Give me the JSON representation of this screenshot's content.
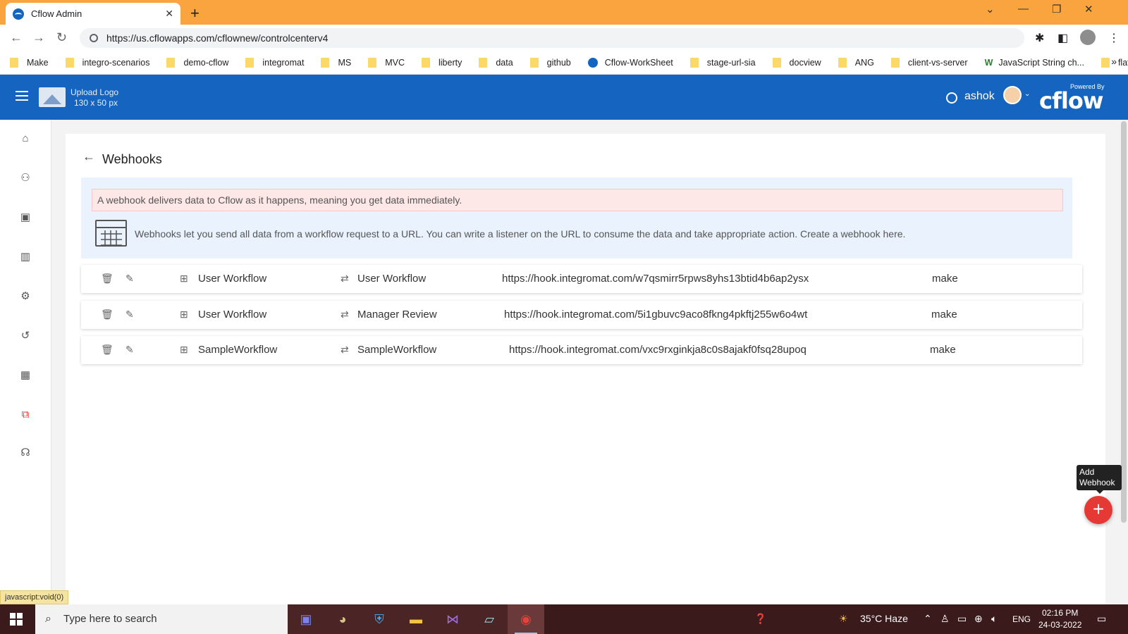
{
  "browser": {
    "tab_title": "Cflow Admin",
    "url": "https://us.cflowapps.com/cflownew/controlcenterv4",
    "bookmarks": [
      {
        "label": "Make",
        "type": "folder"
      },
      {
        "label": "integro-scenarios",
        "type": "folder"
      },
      {
        "label": "demo-cflow",
        "type": "folder"
      },
      {
        "label": "integromat",
        "type": "folder"
      },
      {
        "label": "MS",
        "type": "folder"
      },
      {
        "label": "MVC",
        "type": "folder"
      },
      {
        "label": "liberty",
        "type": "folder"
      },
      {
        "label": "data",
        "type": "folder"
      },
      {
        "label": "github",
        "type": "folder"
      },
      {
        "label": "Cflow-WorkSheet",
        "type": "cflow"
      },
      {
        "label": "stage-url-sia",
        "type": "folder"
      },
      {
        "label": "docview",
        "type": "folder"
      },
      {
        "label": "ANG",
        "type": "folder"
      },
      {
        "label": "client-vs-server",
        "type": "folder"
      },
      {
        "label": "JavaScript String ch...",
        "type": "w"
      },
      {
        "label": "flat",
        "type": "folder"
      }
    ]
  },
  "header": {
    "upload_logo_line1": "Upload Logo",
    "upload_logo_line2": "130 x 50 px",
    "username": "ashok",
    "powered_by": "Powered By",
    "brand": "cflow",
    "brand_color": "#1565c0"
  },
  "sidebar": {
    "items": [
      {
        "icon": "home-icon"
      },
      {
        "icon": "workflow-icon"
      },
      {
        "icon": "calendar-icon"
      },
      {
        "icon": "reports-icon"
      },
      {
        "icon": "user-settings-icon"
      },
      {
        "icon": "history-icon"
      },
      {
        "icon": "dashboard-icon"
      },
      {
        "icon": "integrations-icon",
        "active": true
      },
      {
        "icon": "support-icon"
      }
    ],
    "active_color": "#e53935"
  },
  "page": {
    "title": "Webhooks",
    "notice": "A webhook delivers data to Cflow as it happens, meaning you get data immediately.",
    "info": "Webhooks let you send all data from a workflow request to a URL. You can write a listener on the URL to consume the data and take appropriate action. Create a webhook here."
  },
  "webhooks": [
    {
      "workflow": "User Workflow",
      "stage": "User Workflow",
      "url": "https://hook.integromat.com/w7qsmirr5rpws8yhs13btid4b6ap2ysx",
      "type": "make"
    },
    {
      "workflow": "User Workflow",
      "stage": "Manager Review",
      "url": "https://hook.integromat.com/5i1gbuvc9aco8fkng4pkftj255w6o4wt",
      "type": "make"
    },
    {
      "workflow": "SampleWorkflow",
      "stage": "SampleWorkflow",
      "url": "https://hook.integromat.com/vxc9rxginkja8c0s8ajakf0fsq28upoq",
      "type": "make"
    }
  ],
  "fab": {
    "tooltip": "Add Webhook",
    "symbol": "+",
    "color": "#e53935"
  },
  "status_link": "javascript:void(0)",
  "taskbar": {
    "search_placeholder": "Type here to search",
    "weather": "35°C  Haze",
    "language": "ENG",
    "time": "02:16 PM",
    "date": "24-03-2022"
  }
}
